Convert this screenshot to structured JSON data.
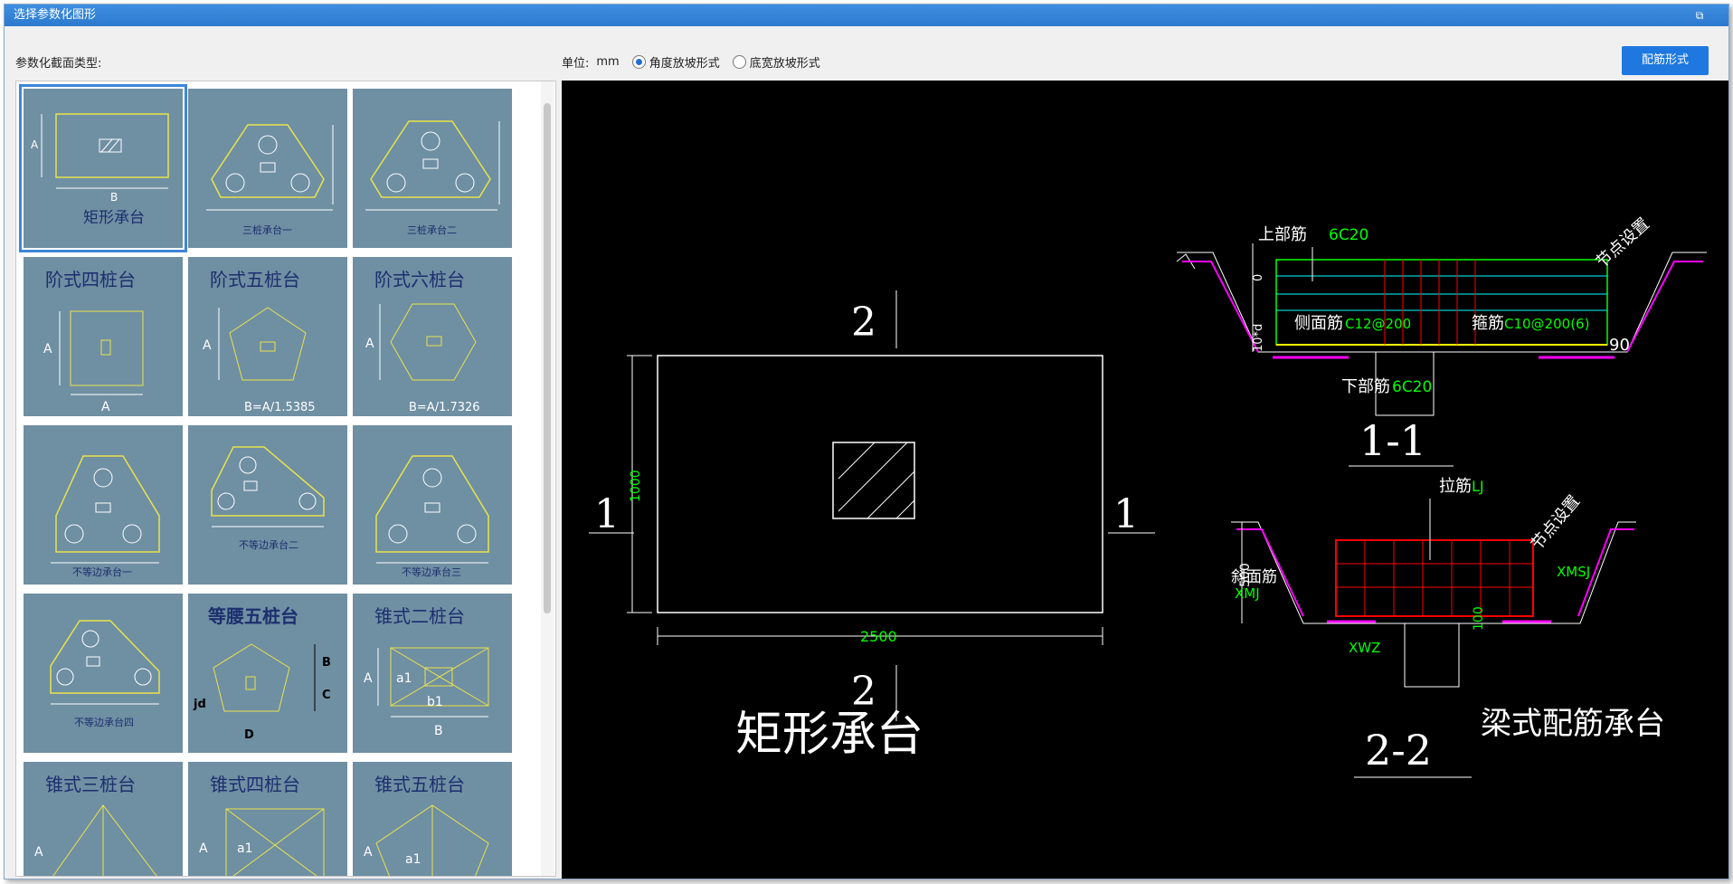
{
  "window": {
    "title": "选择参数化图形",
    "restore_icon": "restore-icon"
  },
  "toolbar": {
    "type_label": "参数化截面类型:",
    "unit_label": "单位:",
    "unit_value": "mm",
    "radio_angle": "角度放坡形式",
    "radio_width": "底宽放坡形式",
    "angle_checked": true,
    "rebar_button": "配筋形式"
  },
  "tiles": [
    {
      "label": "矩形承台",
      "title": ""
    },
    {
      "label": "三桩承台一",
      "title": ""
    },
    {
      "label": "三桩承台二",
      "title": ""
    },
    {
      "label": "",
      "title": "阶式四桩台",
      "sub": "A"
    },
    {
      "label": "",
      "title": "阶式五桩台",
      "sub": "B=A/1.5385"
    },
    {
      "label": "",
      "title": "阶式六桩台",
      "sub": "B=A/1.7326"
    },
    {
      "label": "不等边承台一",
      "title": ""
    },
    {
      "label": "不等边承台二",
      "title": ""
    },
    {
      "label": "不等边承台三",
      "title": ""
    },
    {
      "label": "不等边承台四",
      "title": ""
    },
    {
      "label": "",
      "title": "等腰五桩台",
      "sub": "D"
    },
    {
      "label": "",
      "title": "锥式二桩台",
      "sub": "B"
    },
    {
      "label": "",
      "title": "锥式三桩台"
    },
    {
      "label": "",
      "title": "锥式四桩台"
    },
    {
      "label": "",
      "title": "锥式五桩台"
    }
  ],
  "tile_marks": {
    "A": "A",
    "B": "B",
    "C": "C",
    "a1": "a1",
    "b1": "b1",
    "jd": "jd"
  },
  "drawing": {
    "plan_title": "矩形承台",
    "dim_height": "1000",
    "dim_width": "2500",
    "section_mark_2": "2",
    "section_mark_1": "1",
    "sec11_title": "1-1",
    "sec22_title": "2-2",
    "beam_title": "梁式配筋承台",
    "top_bar_label": "上部筋",
    "top_bar_value": "6C20",
    "side_bar_label": "侧面筋",
    "side_bar_value": "C12@200",
    "stirrup_label": "箍筋",
    "stirrup_value": "C10@200(6)",
    "bottom_bar_label": "下部筋",
    "bottom_bar_value": "6C20",
    "node_label": "节点设置",
    "angle_value": "90",
    "dim_zero": "0",
    "dim_10d": "10*d",
    "tie_label": "拉筋",
    "tie_value": "LJ",
    "slope_label": "斜面筋",
    "slope_value": "XMJ",
    "xmsj": "XMSJ",
    "xwz": "XWZ",
    "dim_500": "500",
    "dim_100": "100"
  }
}
